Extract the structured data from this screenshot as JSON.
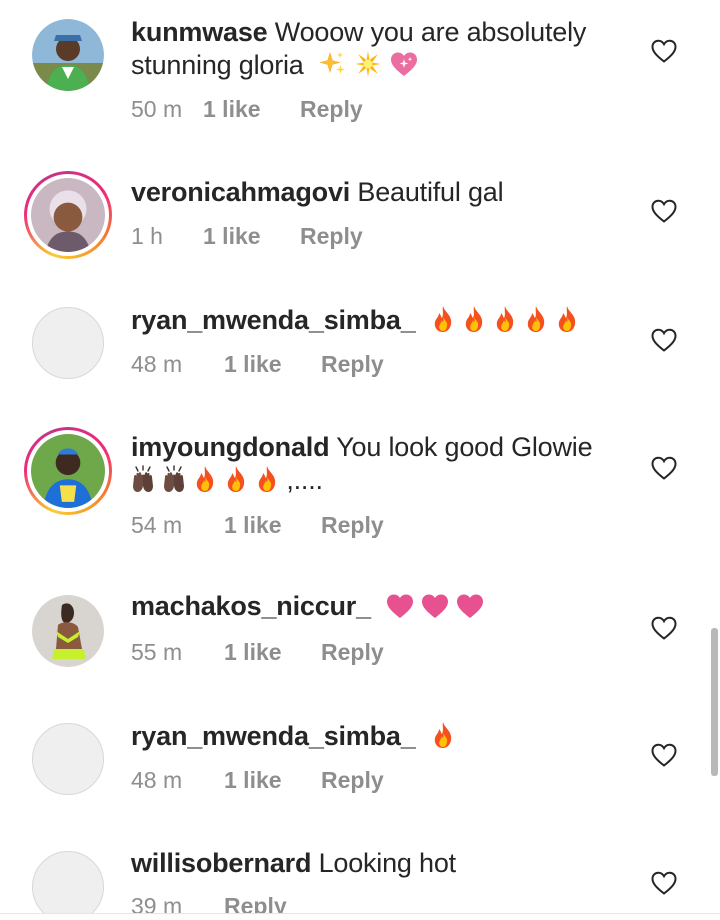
{
  "comments": [
    {
      "username": "kunmwase",
      "text_line1": "Wooow you are absolutely",
      "text_line2": "stunning gloria",
      "emojis": [
        "sparkles",
        "glowing-star",
        "sparkling-heart"
      ],
      "time": "50 m",
      "likes": "1 like",
      "reply": "Reply"
    },
    {
      "username": "veronicahmagovi",
      "text": "Beautiful gal",
      "time": "1 h",
      "likes": "1 like",
      "reply": "Reply"
    },
    {
      "username": "ryan_mwenda_simba_",
      "emojis": [
        "fire",
        "fire",
        "fire",
        "fire",
        "fire"
      ],
      "time": "48 m",
      "likes": "1 like",
      "reply": "Reply"
    },
    {
      "username": "imyoungdonald",
      "text": "You look good Glowie",
      "emojis_line2": [
        "raising-hands",
        "raising-hands",
        "fire",
        "fire",
        "fire"
      ],
      "trailing": ",....",
      "time": "54 m",
      "likes": "1 like",
      "reply": "Reply"
    },
    {
      "username": "machakos_niccur_",
      "emojis": [
        "heart",
        "heart",
        "heart"
      ],
      "time": "55 m",
      "likes": "1 like",
      "reply": "Reply"
    },
    {
      "username": "ryan_mwenda_simba_",
      "emojis": [
        "fire"
      ],
      "time": "48 m",
      "likes": "1 like",
      "reply": "Reply"
    },
    {
      "username": "willisobernard",
      "text": "Looking hot",
      "time": "39 m",
      "reply": "Reply"
    }
  ],
  "icons": {
    "like": "heart-outline-icon",
    "fire": "fire-emoji",
    "heart": "pink-heart-emoji"
  },
  "colors": {
    "text": "#262626",
    "meta": "#8e8e8e",
    "heart_emoji": "#e8518f",
    "fire_outer": "#f4511e",
    "fire_inner": "#ffc107"
  }
}
